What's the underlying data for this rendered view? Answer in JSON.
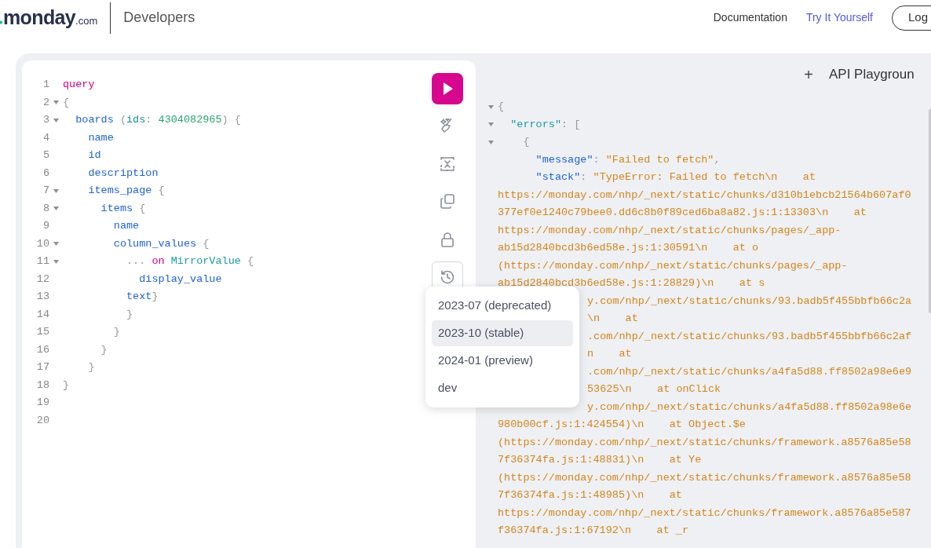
{
  "header": {
    "logo": "monday",
    "logo_suffix": ".com",
    "section": "Developers",
    "links": [
      {
        "label": "Documentation",
        "selected": false
      },
      {
        "label": "Try It Yourself",
        "selected": true
      }
    ],
    "login": "Log"
  },
  "editor": {
    "lines": [
      {
        "number": "1",
        "fold": false,
        "tokens": [
          {
            "t": "query",
            "kind": "keyword"
          }
        ]
      },
      {
        "number": "2",
        "fold": true,
        "tokens": [
          {
            "t": "{",
            "kind": "punct"
          }
        ]
      },
      {
        "number": "3",
        "fold": true,
        "tokens": [
          {
            "t": "  boards",
            "kind": "field"
          },
          {
            "t": " (",
            "kind": "punct"
          },
          {
            "t": "ids",
            "kind": "argument"
          },
          {
            "t": ": ",
            "kind": "punct"
          },
          {
            "t": "4304082965",
            "kind": "number"
          },
          {
            "t": ") {",
            "kind": "punct"
          }
        ]
      },
      {
        "number": "4",
        "fold": false,
        "tokens": [
          {
            "t": "    name",
            "kind": "field"
          }
        ]
      },
      {
        "number": "5",
        "fold": false,
        "tokens": [
          {
            "t": "    id",
            "kind": "field"
          }
        ]
      },
      {
        "number": "6",
        "fold": false,
        "tokens": [
          {
            "t": "    description",
            "kind": "field"
          }
        ]
      },
      {
        "number": "7",
        "fold": true,
        "tokens": [
          {
            "t": "    items_page",
            "kind": "field"
          },
          {
            "t": " {",
            "kind": "punct"
          }
        ]
      },
      {
        "number": "8",
        "fold": true,
        "tokens": [
          {
            "t": "      items",
            "kind": "field"
          },
          {
            "t": " {",
            "kind": "punct"
          }
        ]
      },
      {
        "number": "9",
        "fold": false,
        "tokens": [
          {
            "t": "        name",
            "kind": "field"
          }
        ]
      },
      {
        "number": "10",
        "fold": true,
        "tokens": [
          {
            "t": "        column_values",
            "kind": "field"
          },
          {
            "t": " {",
            "kind": "punct"
          }
        ]
      },
      {
        "number": "11",
        "fold": true,
        "tokens": [
          {
            "t": "          ...",
            "kind": "punct"
          },
          {
            "t": " on",
            "kind": "keyword"
          },
          {
            "t": " MirrorValue",
            "kind": "type"
          },
          {
            "t": " {",
            "kind": "punct"
          }
        ]
      },
      {
        "number": "12",
        "fold": false,
        "tokens": [
          {
            "t": "            display_value",
            "kind": "field"
          }
        ]
      },
      {
        "number": "13",
        "fold": false,
        "tokens": [
          {
            "t": "          text",
            "kind": "field"
          },
          {
            "t": "}",
            "kind": "punct"
          }
        ]
      },
      {
        "number": "14",
        "fold": false,
        "tokens": [
          {
            "t": "          }",
            "kind": "punct"
          }
        ]
      },
      {
        "number": "15",
        "fold": false,
        "tokens": [
          {
            "t": "        }",
            "kind": "punct"
          }
        ]
      },
      {
        "number": "16",
        "fold": false,
        "tokens": [
          {
            "t": "      }",
            "kind": "punct"
          }
        ]
      },
      {
        "number": "17",
        "fold": false,
        "tokens": [
          {
            "t": "    }",
            "kind": "punct"
          }
        ]
      },
      {
        "number": "18",
        "fold": false,
        "tokens": [
          {
            "t": "}",
            "kind": "punct"
          }
        ]
      },
      {
        "number": "19",
        "fold": false
      },
      {
        "number": "20",
        "fold": false
      }
    ]
  },
  "toolbar": [
    {
      "kind": "run"
    },
    {
      "kind": "prettify"
    },
    {
      "kind": "merge"
    },
    {
      "kind": "copy"
    },
    {
      "kind": "lock"
    },
    {
      "kind": "history",
      "expanded": true
    }
  ],
  "version_menu": [
    {
      "label": "2023-07 (deprecated)",
      "selected": false
    },
    {
      "label": "2023-10 (stable)",
      "selected": true
    },
    {
      "label": "2024-01 (preview)",
      "selected": false
    },
    {
      "label": "dev",
      "selected": false
    }
  ],
  "result": {
    "add": "+",
    "title": "API Playgroun",
    "lines": [
      {
        "fold": true,
        "covered": false,
        "tokens": [
          {
            "t": "{",
            "kind": "punct"
          }
        ]
      },
      {
        "fold": true,
        "covered": false,
        "tokens": [
          {
            "t": "  \"errors\"",
            "kind": "key"
          },
          {
            "t": ": [",
            "kind": "punct"
          }
        ]
      },
      {
        "fold": true,
        "covered": false,
        "tokens": [
          {
            "t": "    {",
            "kind": "punct"
          }
        ]
      },
      {
        "fold": false,
        "covered": false,
        "tokens": [
          {
            "t": "      \"message\"",
            "kind": "field"
          },
          {
            "t": ": ",
            "kind": "punct"
          },
          {
            "t": "\"Failed to fetch\"",
            "kind": "string"
          },
          {
            "t": ",",
            "kind": "punct"
          }
        ]
      },
      {
        "fold": false,
        "covered": false,
        "tokens": [
          {
            "t": "      \"stack\"",
            "kind": "field"
          },
          {
            "t": ": ",
            "kind": "punct"
          },
          {
            "t": "\"TypeError: Failed to fetch\\n    at",
            "kind": "string"
          }
        ]
      },
      {
        "fold": false,
        "covered": false,
        "tokens": [
          {
            "t": "https://monday.com/nhp/_next/static/chunks/d310b1ebcb21564b607af0",
            "kind": "string"
          }
        ]
      },
      {
        "fold": false,
        "covered": false,
        "tokens": [
          {
            "t": "377ef0e1240c79bee0.dd6c8b0f89ced6ba8a82.js:1:13303\\n    at",
            "kind": "string"
          }
        ]
      },
      {
        "fold": false,
        "covered": false,
        "tokens": [
          {
            "t": "https://monday.com/nhp/_next/static/chunks/pages/_app-",
            "kind": "string"
          }
        ]
      },
      {
        "fold": false,
        "covered": false,
        "tokens": [
          {
            "t": "ab15d2840bcd3b6ed58e.js:1:30591\\n    at o",
            "kind": "string"
          }
        ]
      },
      {
        "fold": false,
        "covered": false,
        "tokens": [
          {
            "t": "(https://monday.com/nhp/_next/static/chunks/pages/_app-",
            "kind": "string"
          }
        ]
      },
      {
        "fold": false,
        "covered": false,
        "tokens": [
          {
            "t": "ab15d2840bcd3b6ed58e.js:1:28829)\\n    at s",
            "kind": "string"
          }
        ]
      },
      {
        "fold": false,
        "covered": true,
        "tokens": [
          {
            "t": "y.com/nhp/_next/static/chunks/93.badb5f455bbfb66c2a",
            "kind": "string"
          }
        ]
      },
      {
        "fold": false,
        "covered": true,
        "tokens": [
          {
            "t": "\\n    at",
            "kind": "string"
          }
        ]
      },
      {
        "fold": false,
        "covered": true,
        "tokens": [
          {
            "t": ".com/nhp/_next/static/chunks/93.badb5f455bbfb66c2af",
            "kind": "string"
          }
        ]
      },
      {
        "fold": false,
        "covered": true,
        "tokens": [
          {
            "t": "n    at",
            "kind": "string"
          }
        ]
      },
      {
        "fold": false,
        "covered": true,
        "tokens": [
          {
            "t": ".com/nhp/_next/static/chunks/a4fa5d88.ff8502a98e6e9",
            "kind": "string"
          }
        ]
      },
      {
        "fold": false,
        "covered": true,
        "tokens": [
          {
            "t": "53625\\n    at onClick",
            "kind": "string"
          }
        ]
      },
      {
        "fold": false,
        "covered": true,
        "tokens": [
          {
            "t": "y.com/nhp/_next/static/chunks/a4fa5d88.ff8502a98e6e",
            "kind": "string"
          }
        ]
      },
      {
        "fold": false,
        "covered": false,
        "tokens": [
          {
            "t": "980b00cf.js:1:424554)\\n    at Object.$e",
            "kind": "string"
          }
        ]
      },
      {
        "fold": false,
        "covered": false,
        "tokens": [
          {
            "t": "(https://monday.com/nhp/_next/static/chunks/framework.a8576a85e58",
            "kind": "string"
          }
        ]
      },
      {
        "fold": false,
        "covered": false,
        "tokens": [
          {
            "t": "7f36374fa.js:1:48831)\\n    at Ye",
            "kind": "string"
          }
        ]
      },
      {
        "fold": false,
        "covered": false,
        "tokens": [
          {
            "t": "(https://monday.com/nhp/_next/static/chunks/framework.a8576a85e58",
            "kind": "string"
          }
        ]
      },
      {
        "fold": false,
        "covered": false,
        "tokens": [
          {
            "t": "7f36374fa.js:1:48985)\\n    at",
            "kind": "string"
          }
        ]
      },
      {
        "fold": false,
        "covered": false,
        "tokens": [
          {
            "t": "https://monday.com/nhp/_next/static/chunks/framework.a8576a85e587",
            "kind": "string"
          }
        ]
      },
      {
        "fold": false,
        "covered": false,
        "tokens": [
          {
            "t": "f36374fa.js:1:67192\\n    at _r",
            "kind": "string"
          }
        ]
      }
    ]
  }
}
